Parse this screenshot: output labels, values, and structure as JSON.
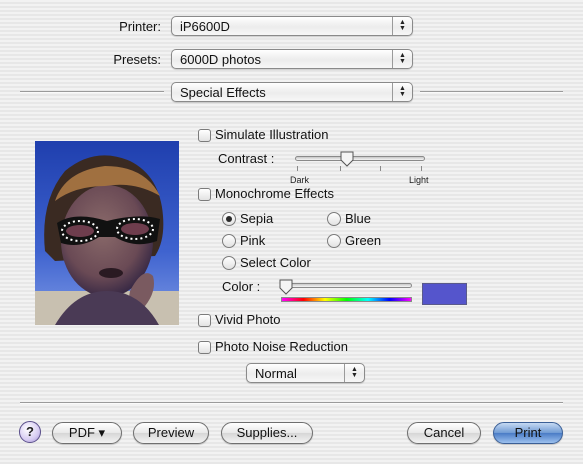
{
  "printer": {
    "label": "Printer:",
    "value": "iP6600D"
  },
  "presets": {
    "label": "Presets:",
    "value": "6000D photos"
  },
  "section": {
    "value": "Special Effects"
  },
  "simulate_illustration": {
    "label": "Simulate Illustration",
    "checked": false,
    "contrast_label": "Contrast :",
    "dark_label": "Dark",
    "light_label": "Light",
    "contrast_level": 0.4
  },
  "monochrome": {
    "label": "Monochrome Effects",
    "checked": false,
    "options": {
      "sepia": "Sepia",
      "blue": "Blue",
      "pink": "Pink",
      "green": "Green",
      "select_color": "Select Color"
    },
    "selected": "sepia",
    "color_label": "Color :",
    "color_level": 0.0,
    "swatch_color": "#5555cc"
  },
  "vivid_photo": {
    "label": "Vivid Photo",
    "checked": false
  },
  "noise_reduction": {
    "label": "Photo Noise Reduction",
    "checked": false,
    "level": "Normal"
  },
  "buttons": {
    "help": "?",
    "pdf": "PDF ▾",
    "preview": "Preview",
    "supplies": "Supplies...",
    "cancel": "Cancel",
    "print": "Print"
  },
  "icons": {
    "popup_arrows": "popup-arrows-icon",
    "help": "help-icon",
    "slider_thumb": "slider-thumb-icon"
  },
  "colors": {
    "default_button": "#4a7cc6",
    "swatch": "#5555cc"
  }
}
